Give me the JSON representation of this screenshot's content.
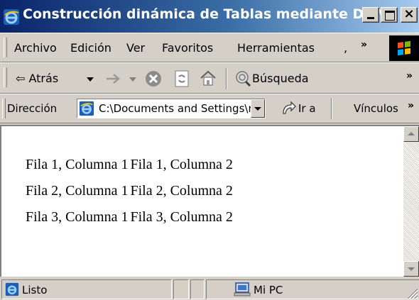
{
  "window": {
    "title": "Construcción dinámica de Tablas mediante DOM...",
    "controls": {
      "minimize": "_",
      "maximize": "□",
      "close": "×"
    }
  },
  "menubar": {
    "items": [
      "Archivo",
      "Edición",
      "Ver",
      "Favoritos",
      "Herramientas",
      ","
    ],
    "overflow": "»"
  },
  "toolbar": {
    "back_label": "⇦ Atrás",
    "search_label": "Búsqueda",
    "overflow": "»",
    "icons": [
      "back-arrow-icon",
      "dropdown-icon",
      "forward-arrow-icon",
      "stop-icon",
      "refresh-icon",
      "home-icon",
      "search-icon"
    ]
  },
  "address": {
    "label": "Dirección",
    "value": "C:\\Documents and Settings\\r",
    "go_label": "Ir a",
    "links_label": "Vínculos",
    "overflow": "»"
  },
  "page": {
    "rows": [
      [
        "Fila 1, Columna 1",
        "Fila 1, Columna 2"
      ],
      [
        "Fila 2, Columna 1",
        "Fila 2, Columna 2"
      ],
      [
        "Fila 3, Columna 1",
        "Fila 3, Columna 2"
      ]
    ]
  },
  "status": {
    "text": "Listo",
    "zone": "Mi PC"
  },
  "colors": {
    "titlebar_start": "#0a246a",
    "titlebar_end": "#a6caf0",
    "chrome": "#d4d0c8"
  }
}
